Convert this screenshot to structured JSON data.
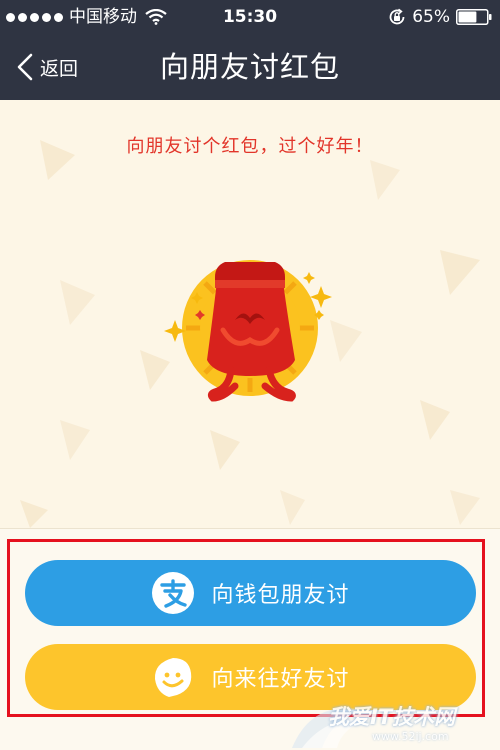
{
  "status_bar": {
    "carrier": "中国移动",
    "time": "15:30",
    "battery": "65%",
    "battery_level": 0.65,
    "icons": [
      "signal-dots-icon",
      "wifi-icon",
      "rotation-lock-icon",
      "battery-icon"
    ]
  },
  "nav": {
    "back_label": "返回",
    "title": "向朋友讨红包",
    "icons": [
      "chevron-left-icon"
    ]
  },
  "content": {
    "tagline": "向朋友讨个红包，过个好年！",
    "illustration": "red-envelope-mascot"
  },
  "actions": {
    "wallet_button": {
      "label": "向钱包朋友讨",
      "icon": "alipay-icon",
      "color": "#2d9ee4"
    },
    "friends_button": {
      "label": "向来往好友讨",
      "icon": "laiwang-icon",
      "color": "#fdc52c"
    }
  },
  "annotation": {
    "highlight_color": "#e5111e"
  },
  "watermark": {
    "text": "我爱IT技术网",
    "url": "www.52ij.com"
  },
  "colors": {
    "bar_bg": "#2f3442",
    "page_bg": "#fdf6e6",
    "tagline_red": "#e2352a"
  }
}
